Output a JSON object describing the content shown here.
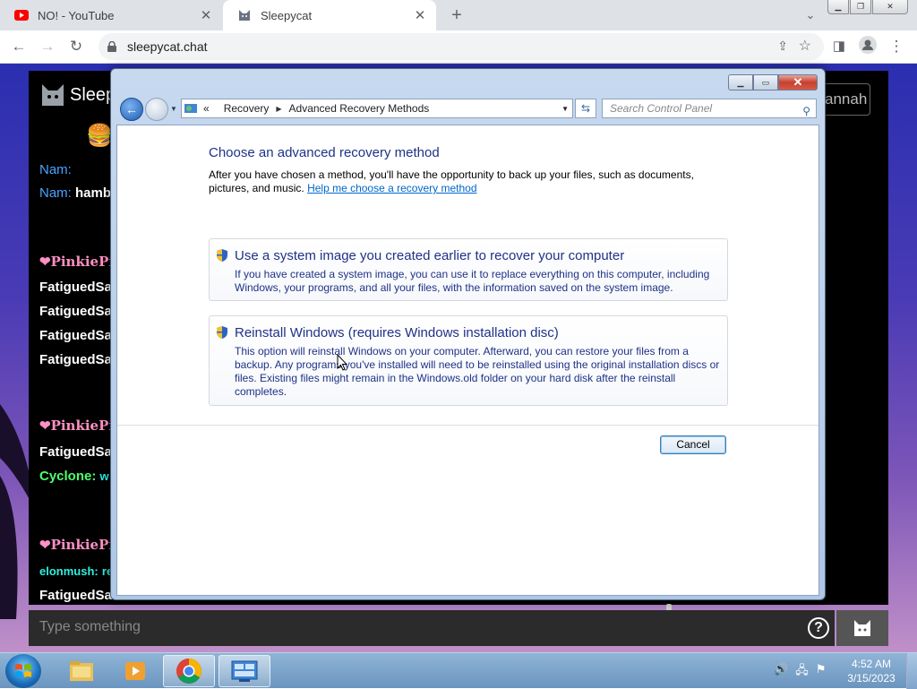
{
  "browser": {
    "tabs": [
      {
        "title": "NO! - YouTube",
        "icon": "youtube-icon",
        "active": false
      },
      {
        "title": "Sleepycat",
        "icon": "sleepycat-icon",
        "active": true
      }
    ],
    "url": "sleepycat.chat"
  },
  "chat": {
    "brand": "Sleep",
    "user_button": "annah",
    "lines": [
      {
        "name": "Nam:",
        "text": ""
      },
      {
        "name": "Nam:",
        "text": "hamb"
      },
      {
        "name": "❤PinkiePie",
        "text": ""
      },
      {
        "name": "",
        "text": "FatiguedSa"
      },
      {
        "name": "",
        "text": "FatiguedSa"
      },
      {
        "name": "",
        "text": "FatiguedSa"
      },
      {
        "name": "",
        "text": "FatiguedSa"
      },
      {
        "name": "❤PinkiePie",
        "text": ""
      },
      {
        "name": "",
        "text": "FatiguedSa"
      },
      {
        "name": "Cyclone:",
        "text": "w"
      },
      {
        "name": "❤PinkiePie",
        "text": ""
      },
      {
        "name": "elonmush:",
        "text": "re"
      },
      {
        "name": "",
        "text": "FatiguedSa"
      }
    ],
    "input_placeholder": "Type something"
  },
  "dialog": {
    "breadcrumb": [
      "Recovery",
      "Advanced Recovery Methods"
    ],
    "search_placeholder": "Search Control Panel",
    "title": "Choose an advanced recovery method",
    "description": "After you have chosen a method, you'll have the opportunity to back up your files, such as documents, pictures, and music.",
    "help_link": "Help me choose a recovery method",
    "options": [
      {
        "title": "Use a system image you created earlier to recover your computer",
        "description": "If you have created a system image, you can use it to replace everything on this computer, including Windows, your programs, and all your files, with the information saved on the system image."
      },
      {
        "title": "Reinstall Windows (requires Windows installation disc)",
        "description": "This option will reinstall Windows on your computer. Afterward, you can restore your files from a backup. Any programs you've installed will need to be reinstalled using the original installation discs or files. Existing files might remain in the Windows.old folder on your hard disk after the reinstall completes."
      }
    ],
    "cancel_label": "Cancel"
  },
  "taskbar": {
    "time": "4:52 AM",
    "date": "3/15/2023"
  },
  "colors": {
    "dialog_link": "#1e3287",
    "chrome_tabstrip": "#dee1e6",
    "taskbar": "#6b95bf"
  }
}
